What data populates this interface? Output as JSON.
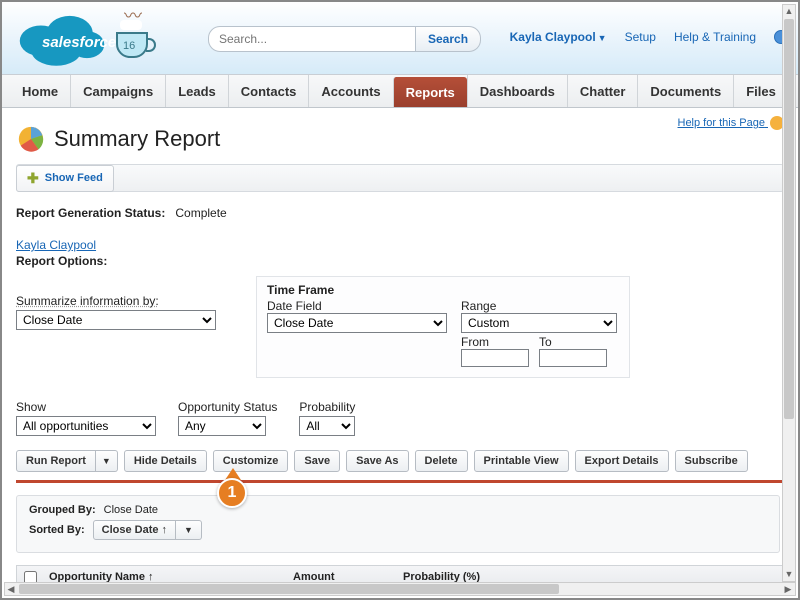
{
  "brand": {
    "name": "salesforce",
    "mug_number": "16"
  },
  "search": {
    "placeholder": "Search...",
    "button": "Search"
  },
  "topnav": {
    "user": "Kayla Claypool",
    "setup": "Setup",
    "help": "Help & Training"
  },
  "tabs": [
    "Home",
    "Campaigns",
    "Leads",
    "Contacts",
    "Accounts",
    "Reports",
    "Dashboards",
    "Chatter",
    "Documents",
    "Files"
  ],
  "active_tab": 5,
  "help_for_page": "Help for this Page",
  "page_title": "Summary Report",
  "show_feed": "Show Feed",
  "status": {
    "label": "Report Generation Status:",
    "value": "Complete"
  },
  "owner": "Kayla Claypool",
  "report_options_label": "Report Options:",
  "summarize": {
    "label": "Summarize information by:",
    "value": "Close Date"
  },
  "timeframe": {
    "title": "Time Frame",
    "date_field_label": "Date Field",
    "date_field_value": "Close Date",
    "range_label": "Range",
    "range_value": "Custom",
    "from_label": "From",
    "to_label": "To"
  },
  "filters": {
    "show_label": "Show",
    "show_value": "All opportunities",
    "status_label": "Opportunity Status",
    "status_value": "Any",
    "prob_label": "Probability",
    "prob_value": "All"
  },
  "buttons": {
    "run": "Run Report",
    "hide": "Hide Details",
    "customize": "Customize",
    "save": "Save",
    "saveas": "Save As",
    "delete": "Delete",
    "printable": "Printable View",
    "export": "Export Details",
    "subscribe": "Subscribe"
  },
  "callout_number": "1",
  "grouping": {
    "grouped_by_label": "Grouped By:",
    "grouped_by_value": "Close Date",
    "sorted_by_label": "Sorted By:",
    "sorted_by_value": "Close Date ↑"
  },
  "columns": {
    "name": "Opportunity Name ↑",
    "amount": "Amount",
    "prob": "Probability (%)"
  }
}
